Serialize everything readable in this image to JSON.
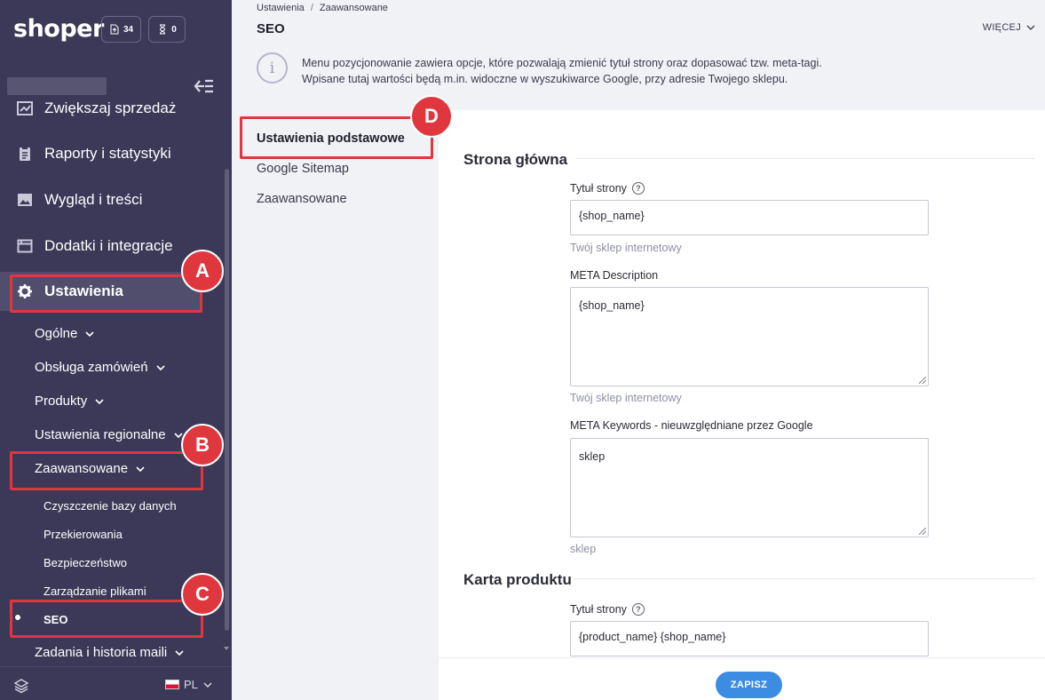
{
  "brand": {
    "logo": "shoper",
    "counter_1": "34",
    "counter_2": "0"
  },
  "sidebar": {
    "nav": [
      {
        "label": "Zwiększaj sprzedaż",
        "icon": "chart-icon"
      },
      {
        "label": "Raporty i statystyki",
        "icon": "clipboard-icon"
      },
      {
        "label": "Wygląd i treści",
        "icon": "image-icon"
      },
      {
        "label": "Dodatki i integracje",
        "icon": "window-icon"
      },
      {
        "label": "Ustawienia",
        "icon": "gear-icon"
      }
    ],
    "settings_sub": [
      {
        "label": "Ogólne"
      },
      {
        "label": "Obsługa zamówień"
      },
      {
        "label": "Produkty"
      },
      {
        "label": "Ustawienia regionalne"
      },
      {
        "label": "Zaawansowane"
      }
    ],
    "advanced_sub": [
      {
        "label": "Czyszczenie bazy danych"
      },
      {
        "label": "Przekierowania"
      },
      {
        "label": "Bezpieczeństwo"
      },
      {
        "label": "Zarządzanie plikami"
      },
      {
        "label": "SEO"
      }
    ],
    "after": {
      "label": "Zadania i historia maili"
    },
    "language": "PL"
  },
  "header": {
    "breadcrumb": [
      "Ustawienia",
      "Zaawansowane"
    ],
    "breadcrumb_sep": "/",
    "title": "SEO",
    "more_label": "WIĘCEJ",
    "info_line_1": "Menu pozycjonowanie zawiera opcje, które pozwalają zmienić tytuł strony oraz dopasować tzw. meta-tagi.",
    "info_line_2": "Wpisane tutaj wartości będą m.in. widoczne w wyszukiwarce Google, przy adresie Twojego sklepu."
  },
  "subnav": {
    "items": [
      {
        "label": "Ustawienia podstawowe"
      },
      {
        "label": "Google Sitemap"
      },
      {
        "label": "Zaawansowane"
      }
    ]
  },
  "main": {
    "home": {
      "title": "Strona główna",
      "page_title_label": "Tytuł strony",
      "page_title_value": "{shop_name}",
      "page_title_hint": "Twój sklep internetowy",
      "meta_desc_label": "META Description",
      "meta_desc_value": "{shop_name}",
      "meta_desc_hint": "Twój sklep internetowy",
      "meta_kw_label": "META Keywords - nieuwzględniane przez Google",
      "meta_kw_value": "sklep",
      "meta_kw_hint": "sklep"
    },
    "product": {
      "title": "Karta produktu",
      "page_title_label": "Tytuł strony",
      "page_title_value": "{product_name} {shop_name}"
    }
  },
  "footer": {
    "save_label": "ZAPISZ"
  },
  "callouts": [
    "A",
    "B",
    "C",
    "D"
  ],
  "colors": {
    "sidebar_bg": "#3b3957",
    "accent": "#3d8ce3",
    "callout": "#e0373f"
  }
}
